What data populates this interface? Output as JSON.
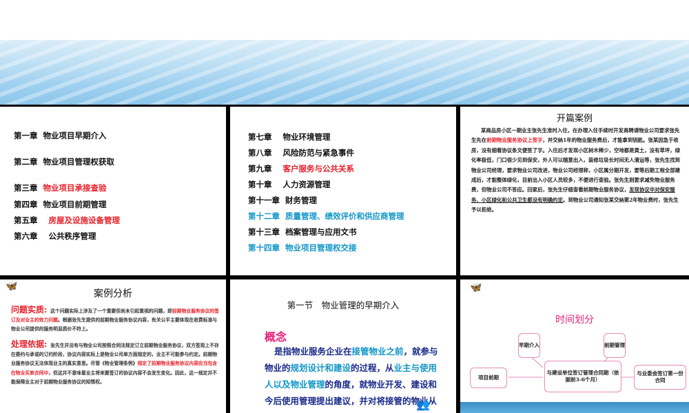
{
  "slide1": {
    "chapters": [
      {
        "num": "第一章",
        "title": "物业项目早期介入"
      },
      {
        "num": "第二章",
        "title": "物业项目管理权获取"
      },
      {
        "num": "第三章",
        "title": "物业项目承接查验"
      },
      {
        "num": "第四章",
        "title": "物业项目前期管理"
      },
      {
        "num": "第五章",
        "title": "房屋及设施设备管理"
      },
      {
        "num": "第六章",
        "title": "公共秩序管理"
      }
    ]
  },
  "slide2": {
    "chapters": [
      {
        "num": "第七章",
        "title": "物业环境管理"
      },
      {
        "num": "第八章",
        "title": "风险防范与紧急事件"
      },
      {
        "num": "第九章",
        "title": "客户服务与公共关系"
      },
      {
        "num": "第十章",
        "title": "人力资源管理"
      },
      {
        "num": "第十一章",
        "title": "财务管理"
      },
      {
        "num": "第十二章",
        "title": "质量管理、绩效评价和供应商管理"
      },
      {
        "num": "第十三章",
        "title": "档案管理与应用文书"
      },
      {
        "num": "第十四章",
        "title": "物业项目管理权交接"
      }
    ]
  },
  "slide3": {
    "title": "开篇案例",
    "p1": "某商品房小区一期业主张先生准时入住，在办理入住手续时开发商聘请物业公司要求张先生先在",
    "p1_red": "前期物业服务协议上签字",
    "p2": "，并交纳1年的物业服务费后，才能拿到钥匙。张某因急于收房，没有细看协议条文便签了字。入住后才发现小区树木稀少，空地都是黄土，没有草坪，绿化率极低，门口很少见到保安，外人可以随意出入，装修垃圾长时间无人清运等，张先生找到物业公司经理，要求物业公司改进，物业公司经理称，小区属分期开发，要等后期工程全部建成后，才能整体绿化，目前出入小区人员较多，不便进行查验。张先生则要求减免物业服务费，但物业公司不答应。回家后，张先生仔细查看前期物业服务协议，",
    "p2_u": "发现协议中对保安服务、小区绿化和公共卫生都没有明确约定",
    "p3": "。到物业公司通知张某交纳第2年物业费时，张先生予以拒绝。"
  },
  "slide4": {
    "title": "案例分析",
    "label1": "问题实质:",
    "t1a": "这个问题实际上涉及了一个重要但尚未引起重视的问题，即",
    "t1_red": "前期物业服务协议的签订及对业主的效力问题",
    "t1b": "。根据张先生提供的前期物业服务协议内容，有关公平主要体现在收费标准与物业公司提供的服务明显质价不符上。",
    "label2": "处理依据:",
    "t2a": "张先生并没有与物业公司按照合同法规定订立前期物业服务协议，双方签现上不存在委约与承诺的订约阶段，协议内容实际上是物业公司单方面规定的，业主不可能参与约定。前期物业服务协议无法体现业主的真实意思。尽管《物业管理条例》",
    "t2_red": "规定了前期物业服务协议内容应当包含在物业买卖合同中",
    "t2b": "，但这并不意味着业主将来要签订的协议内容不会发生变化。因此，这一规定并不能保障业主对于前期物业服务协议的知情权。"
  },
  "slide5": {
    "title": "第一节　物业管理的早期介入",
    "heading": "概念",
    "b1": "是指物业服务企业在",
    "b1_hl": "接管物业之前",
    "b2": "，就参与物业的",
    "b2_hl": "规划设计和建设",
    "b3": "的过程，从",
    "b3_hl": "业主与使用人以及物业管理",
    "b4": "的角度，就物业开发、建设和今后使用管理提出建议，并对将接管的物业从物质上和组织上做好准备。"
  },
  "slide6": {
    "title": "时间划分",
    "boxes": {
      "early": "早期介入",
      "preperiod": "前期管理",
      "project": "项目前期",
      "contract": "与建设单位签订管理合同期（依据前3-6个月）",
      "owner": "与业委会签订第一份合同"
    }
  }
}
